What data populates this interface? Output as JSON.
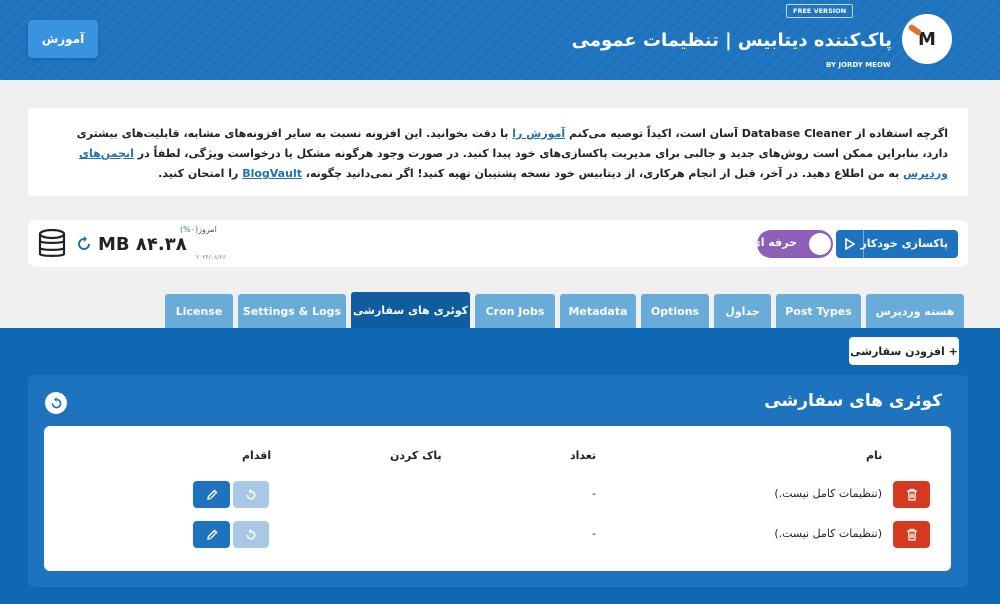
{
  "header": {
    "tutorial_button": "آموزش",
    "free_badge": "FREE VERSION",
    "title": "پاک‌کننده دیتابیس | تنظیمات عمومی",
    "by": "BY JORDY MEOW",
    "logo_text": "M"
  },
  "notice": {
    "p1": "اگرچه استفاده از Database Cleaner آسان است، اکیداً توصیه می‌کنم ",
    "link_tutorial": "آموزش را",
    "p2": " با دقت بخوانید. این افزونه نسبت به سایر افزونه‌های مشابه، قابلیت‌های بیشتری دارد، بنابراین ممکن است روش‌های جدید و جالبی برای مدیریت پاکسازی‌های خود پیدا کنید. در صورت وجود هرگونه مشکل یا درخواست ویژگی، لطفاً در ",
    "link_forum": "انجمن‌های وردپرس",
    "p3": " به من اطلاع دهید. در آخر، قبل از انجام هرکاری، از دیتابیس خود نسخه پشتیبان تهیه کنید! اگر نمی‌دانید چگونه، ",
    "link_blogvault": "BlogVault",
    "p4": " را امتحان کنید."
  },
  "stats": {
    "size": "MB ۸۴.۳۸",
    "today_label": "امروز",
    "today_pct": "(۰%)",
    "date": "۲۰۲۴/۰۸/۲۶"
  },
  "controls": {
    "pro_toggle": "حرفه ای",
    "auto_clean": "پاکسازی خودکار"
  },
  "tabs": [
    {
      "label": "License"
    },
    {
      "label": "Settings & Logs"
    },
    {
      "label": "کوئری های سفارشی"
    },
    {
      "label": "Cron Jobs"
    },
    {
      "label": "Metadata"
    },
    {
      "label": "Options"
    },
    {
      "label": "جداول"
    },
    {
      "label": "Post Types"
    },
    {
      "label": "هسته وردپرس"
    }
  ],
  "active_tab": "کوئری های سفارشی",
  "panel": {
    "add_button": "+ افزودن سفارشی",
    "title": "کوئری های سفارشی",
    "columns": {
      "name": "نام",
      "count": "تعداد",
      "clean": "پاک کردن",
      "action": "اقدام"
    },
    "rows": [
      {
        "name": "(تنظیمات کامل نیست.)",
        "count": "-"
      },
      {
        "name": "(تنظیمات کامل نیست.)",
        "count": "-"
      }
    ]
  },
  "colors": {
    "header_blue": "#1e73be",
    "panel_blue": "#0f68b3",
    "tab_inactive": "#6aacd9",
    "tab_active": "#0f5c9e",
    "delete_red": "#d63b1f",
    "pro_purple": "#8e5fb8"
  },
  "icons": [
    "database-icon",
    "refresh-icon",
    "play-icon",
    "trash-icon",
    "reset-icon",
    "pencil-icon"
  ]
}
